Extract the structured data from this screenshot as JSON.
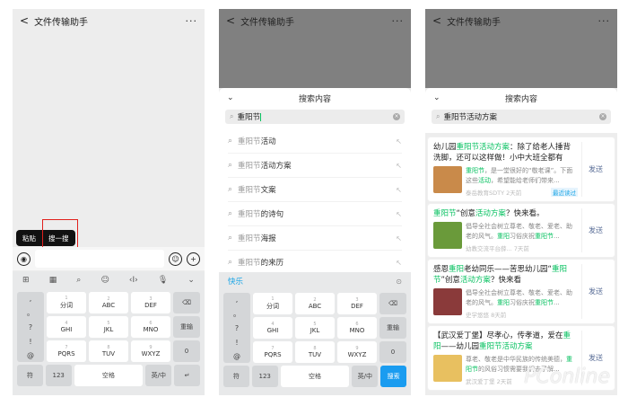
{
  "chat_title": "文件传输助手",
  "more": "···",
  "back": "<",
  "popup": {
    "paste": "粘贴",
    "search": "搜一搜"
  },
  "toolbar_icons": [
    "grid-icon",
    "keyboard-icon",
    "search-icon",
    "emoji-icon",
    "cursor-icon",
    "mic-icon",
    "chevron-down-icon"
  ],
  "toolbar_glyphs": [
    "⊞",
    "▦",
    "⌕",
    "☺",
    "‹I›",
    "🎙",
    "⌄"
  ],
  "keyboard": {
    "side": [
      ",",
      "。",
      "?",
      "!",
      "@"
    ],
    "keys": [
      {
        "n": "1",
        "l": "分词"
      },
      {
        "n": "2",
        "l": "ABC"
      },
      {
        "n": "3",
        "l": "DEF"
      },
      {
        "n": "4",
        "l": "GHI"
      },
      {
        "n": "5",
        "l": "JKL"
      },
      {
        "n": "6",
        "l": "MNO"
      },
      {
        "n": "7",
        "l": "PQRS"
      },
      {
        "n": "8",
        "l": "TUV"
      },
      {
        "n": "9",
        "l": "WXYZ"
      }
    ],
    "right": [
      "⌫",
      "重输",
      "0"
    ],
    "symbols": "符",
    "num": "123",
    "space": "空格",
    "lang": "英/中",
    "enter": "↵",
    "search": "搜索"
  },
  "search_panel": {
    "title": "搜索内容",
    "query": "重阳节",
    "query2": "重阳节活动方案",
    "suggestions": [
      {
        "pre": "重阳节",
        "rest": "活动"
      },
      {
        "pre": "重阳节",
        "rest": "活动方案"
      },
      {
        "pre": "重阳节",
        "rest": "文案"
      },
      {
        "pre": "重阳节",
        "rest": "的诗句"
      },
      {
        "pre": "重阳节",
        "rest": "海报"
      },
      {
        "pre": "重阳节",
        "rest": "的来历"
      }
    ],
    "candidate": "快乐"
  },
  "results": [
    {
      "title": [
        "幼儿园",
        "重阳节活动方案",
        "：除了给老人捶背洗脚，还可以这样做！小中大班全都有"
      ],
      "desc": [
        "重阳节",
        "，是一堂很好的“敬老课”。下面这些",
        "活动",
        "，希望能给老师们带来..."
      ],
      "source": "泰岳教育SDTY",
      "time": "2天前",
      "badge": "最近读过",
      "send": "发送",
      "thumb": "#c98a4a"
    },
    {
      "title": [
        "",
        "重阳节",
        "“创意",
        "活动方案",
        "？快来看。"
      ],
      "desc": [
        "倡导全社会树立尊老、敬老、爱老、助老的风气。",
        "重阳",
        "习俗庆祝",
        "重阳节",
        "..."
      ],
      "source": "幼教交流平台薛...",
      "time": "7天前",
      "send": "发送",
      "thumb": "#6a9a3a"
    },
    {
      "title": [
        "感恩",
        "重阳",
        "老幼同乐——苦思幼儿园“",
        "重阳节",
        "”创意",
        "活动方案",
        "？快来看"
      ],
      "desc": [
        "倡导全社会树立尊老、敬老、爱老、助老的风气。",
        "重阳",
        "习俗庆祝",
        "重阳节",
        "..."
      ],
      "source": "史学悠悠",
      "time": "8天前",
      "send": "发送",
      "thumb": "#8a3a3a"
    },
    {
      "title": [
        "【武汉爱丁堡】尽孝心，传孝道，爱在",
        "重阳",
        "——幼儿园",
        "重阳节活动方案"
      ],
      "desc": [
        "尊老、敬老是中华民族的传统美德，",
        "重阳节",
        "的风俗习惯需要我们去了解..."
      ],
      "source": "武汉爱丁堡",
      "time": "2天前",
      "send": "发送",
      "thumb": "#e8c060"
    }
  ],
  "watermark": "PConline"
}
